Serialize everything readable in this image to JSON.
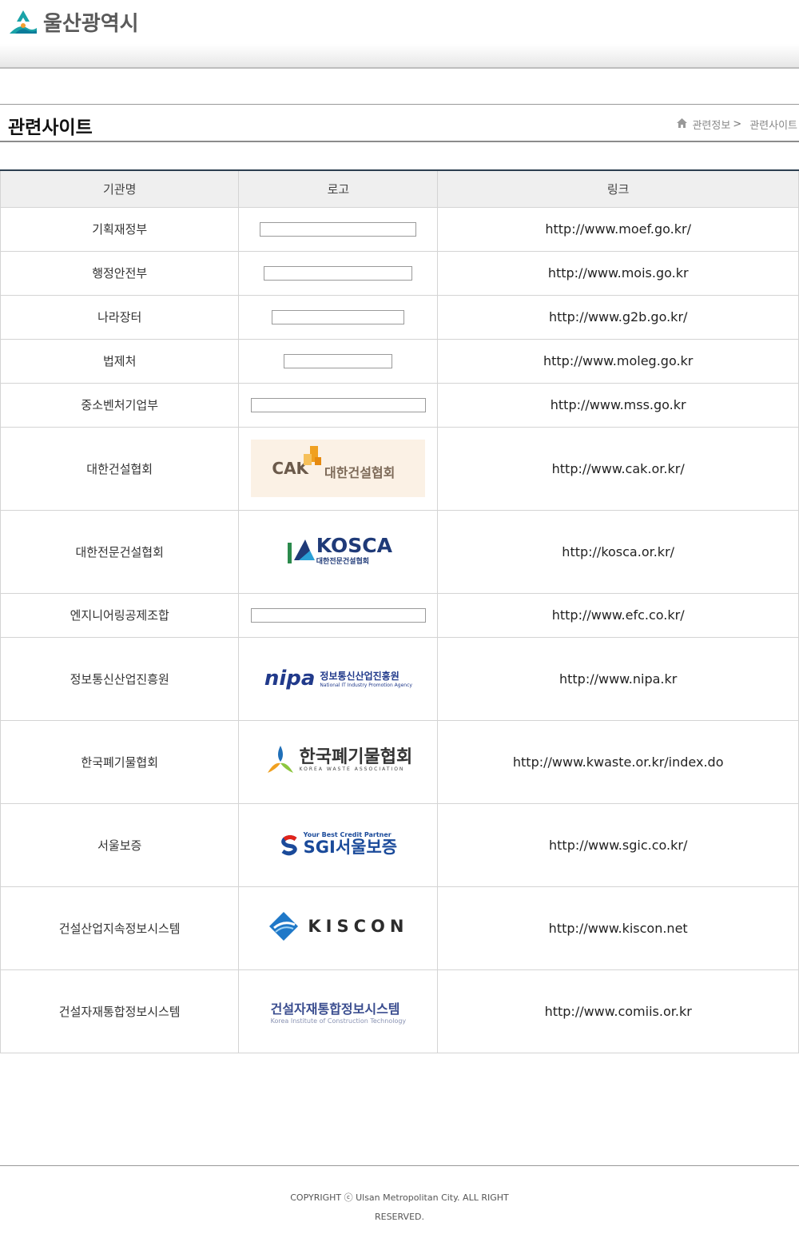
{
  "header": {
    "logo_text": "울산광역시"
  },
  "title_bar": {
    "title": "관련사이트",
    "breadcrumb": [
      {
        "label": "관련정보"
      },
      {
        "label": "관련사이트"
      }
    ],
    "separator": ">"
  },
  "table": {
    "headers": {
      "name": "기관명",
      "logo": "로고",
      "link": "링크"
    },
    "rows": [
      {
        "name": "기획재정부",
        "link": "http://www.moef.go.kr/"
      },
      {
        "name": "행정안전부",
        "link": "http://www.mois.go.kr"
      },
      {
        "name": "나라장터",
        "link": "http://www.g2b.go.kr/"
      },
      {
        "name": "법제처",
        "link": "http://www.moleg.go.kr"
      },
      {
        "name": "중소벤처기업부",
        "link": "http://www.mss.go.kr"
      },
      {
        "name": "대한건설협회",
        "link": "http://www.cak.or.kr/",
        "logo_text": "CAK",
        "logo_sub": "대한건설협회"
      },
      {
        "name": "대한전문건설협회",
        "link": "http://kosca.or.kr/",
        "logo_text": "KOSCA",
        "logo_sub": "대한전문건설협회"
      },
      {
        "name": "엔지니어링공제조합",
        "link": "http://www.efc.co.kr/"
      },
      {
        "name": "정보통신산업진흥원",
        "link": "http://www.nipa.kr",
        "logo_text": "nipa",
        "logo_sub": "정보통신산업진흥원",
        "logo_eng": "National IT Industry Promotion Agency"
      },
      {
        "name": "한국폐기물협회",
        "link": "http://www.kwaste.or.kr/index.do",
        "logo_text": "한국폐기물협회",
        "logo_eng": "KOREA WASTE ASSOCIATION"
      },
      {
        "name": "서울보증",
        "link": "http://www.sgic.co.kr/",
        "logo_top": "Your Best Credit Partner",
        "logo_text": "SGI서울보증"
      },
      {
        "name": "건설산업지속정보시스템",
        "link": "http://www.kiscon.net",
        "logo_text": "KISCON"
      },
      {
        "name": "건설자재통합정보시스템",
        "link": "http://www.comiis.or.kr",
        "logo_text": "건설자재통합정보시스템",
        "logo_eng": "Korea Institute of Construction Technology"
      }
    ]
  },
  "footer": {
    "copyright_line1": "COPYRIGHT ⓒ Ulsan Metropolitan City. ALL RIGHT",
    "copyright_line2": "RESERVED."
  },
  "colors": {
    "table_top_border": "#2c3e50",
    "header_bg": "#efefef",
    "logo_teal": "#1aa3a8"
  }
}
